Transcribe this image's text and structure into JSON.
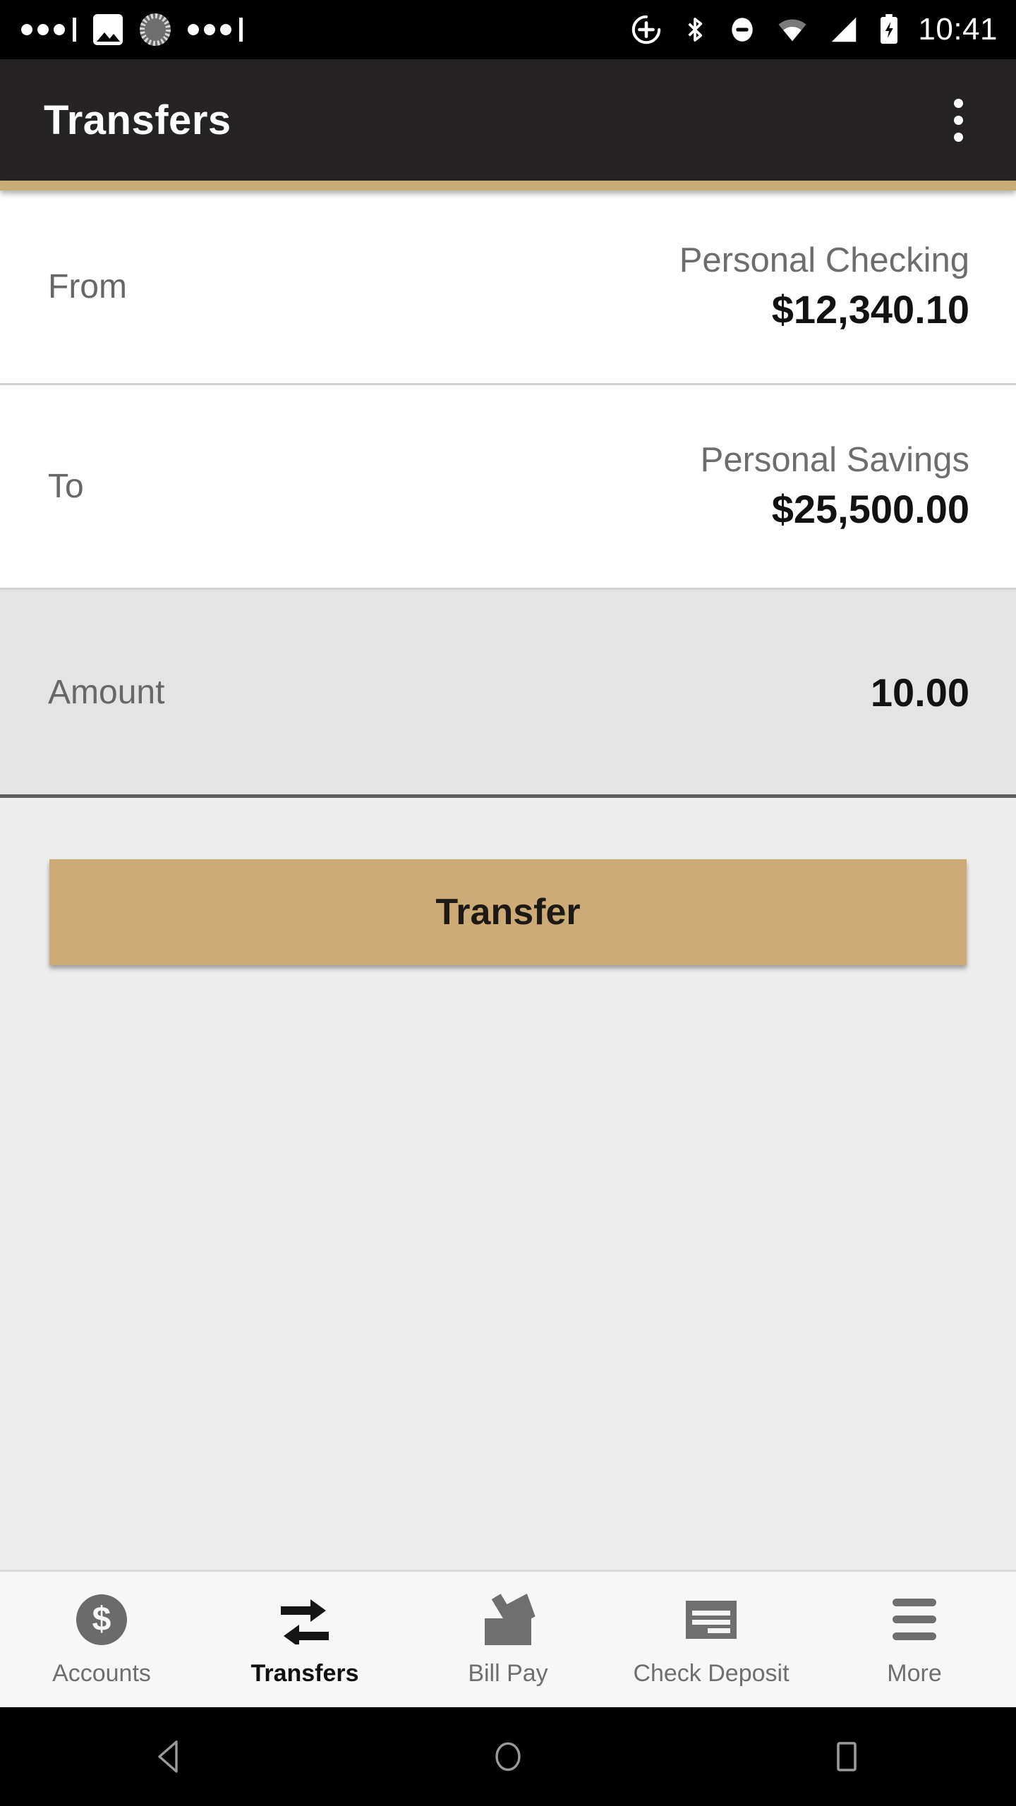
{
  "status_bar": {
    "time": "10:41",
    "left_icons": [
      "notification-dots-icon",
      "image-icon",
      "sync-spinner-icon",
      "notification-dots-icon"
    ],
    "right_icons": [
      "location-add-icon",
      "bluetooth-icon",
      "do-not-disturb-icon",
      "wifi-icon",
      "cellular-signal-icon",
      "battery-charging-icon"
    ]
  },
  "app_bar": {
    "title": "Transfers",
    "overflow_icon": "overflow-menu-icon",
    "accent_color": "#c9ab75",
    "background_color": "#262324"
  },
  "form": {
    "from": {
      "label": "From",
      "account_name": "Personal Checking",
      "balance": "$12,340.10"
    },
    "to": {
      "label": "To",
      "account_name": "Personal Savings",
      "balance": "$25,500.00"
    },
    "amount": {
      "label": "Amount",
      "value": "10.00",
      "placeholder": "0.00"
    }
  },
  "actions": {
    "transfer_label": "Transfer",
    "transfer_color": "#cdab76"
  },
  "bottom_nav": {
    "items": [
      {
        "label": "Accounts",
        "icon": "dollar-coin-icon",
        "active": false
      },
      {
        "label": "Transfers",
        "icon": "transfer-arrows-icon",
        "active": true
      },
      {
        "label": "Bill Pay",
        "icon": "mail-tray-icon",
        "active": false
      },
      {
        "label": "Check Deposit",
        "icon": "check-document-icon",
        "active": false
      },
      {
        "label": "More",
        "icon": "hamburger-menu-icon",
        "active": false
      }
    ]
  },
  "android_nav": {
    "back": "back-triangle-icon",
    "home": "home-circle-icon",
    "recents": "recents-square-icon"
  }
}
